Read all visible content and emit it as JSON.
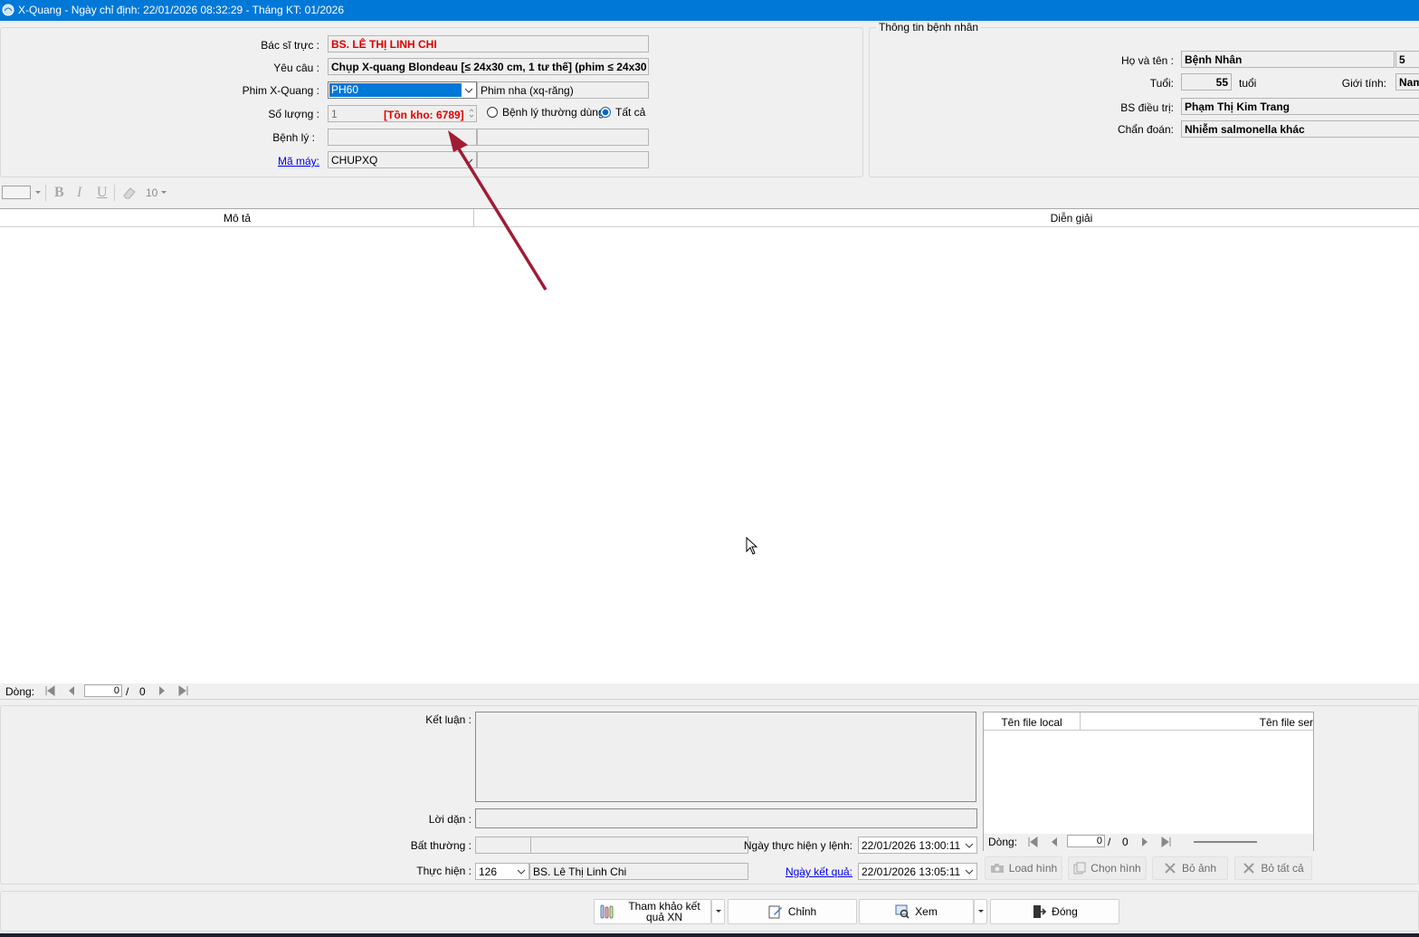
{
  "window": {
    "title": "X-Quang - Ngày chỉ định: 22/01/2026 08:32:29 - Tháng KT: 01/2026"
  },
  "order": {
    "bac_si_truc_label": "Bác sĩ trực :",
    "bac_si_truc_value": "BS. LÊ THỊ LINH CHI",
    "yeu_cau_label": "Yêu câu :",
    "yeu_cau_value": "Chụp X-quang Blondeau [≤ 24x30 cm, 1 tư thế] (phim  ≤ 24x30",
    "phim_label": "Phim X-Quang :",
    "phim_code": "PH60",
    "phim_name": "Phim nha (xq-răng)",
    "so_luong_label": "Số lượng :",
    "so_luong_value": "1",
    "ton_kho": "[Tồn kho: 6789]",
    "radio_benh_ly_thuong_dung": "Bệnh lý thường dùng",
    "radio_tat_ca": "Tất cả",
    "benh_ly_label": "Bệnh lý :",
    "ma_may_label": "Mã máy:",
    "ma_may_value": "CHUPXQ"
  },
  "patient": {
    "group_title": "Thông tin bệnh nhân",
    "ho_ten_label": "Họ và tên :",
    "ho_ten_value": "Bệnh Nhân",
    "ho_ten_extra": "5",
    "tuoi_label": "Tuổi:",
    "tuoi_value": "55",
    "tuoi_unit": "tuổi",
    "gioi_tinh_label": "Giới tính:",
    "gioi_tinh_value": "Nam",
    "bs_dieu_tri_label": "BS điều trị:",
    "bs_dieu_tri_value": "Phạm Thị Kim Trang",
    "chan_doan_label": "Chẩn đoán:",
    "chan_doan_value": "Nhiễm salmonella khác"
  },
  "toolbar": {
    "bold": "B",
    "italic": "I",
    "underline": "U",
    "font_size": "10"
  },
  "grid": {
    "col_mo_ta": "Mô tả",
    "col_dien_giai": "Diễn giải",
    "nav_label": "Dòng:",
    "nav_current": "0",
    "nav_sep": "/",
    "nav_total": "0"
  },
  "result": {
    "ket_luan_label": "Kết luận :",
    "loi_dan_label": "Lời dặn :",
    "bat_thuong_label": "Bất thường :",
    "thuc_hien_label": "Thực hiện :",
    "thuc_hien_code": "126",
    "thuc_hien_name": "BS. Lê Thị Linh Chi",
    "ngay_thuc_hien_label": "Ngày thực hiện y lệnh:",
    "ngay_thuc_hien_value": "22/01/2026  13:00:11",
    "ngay_ket_qua_label": "Ngày kết quả:",
    "ngay_ket_qua_value": "22/01/2026  13:05:11"
  },
  "images": {
    "col_local": "Tên file local",
    "col_server": "Tên file ser",
    "nav_label": "Dòng:",
    "nav_current": "0",
    "nav_sep": "/",
    "nav_total": "0",
    "load_hinh": "Load hình",
    "chon_hinh": "Chọn hình",
    "bo_anh": "Bỏ ảnh",
    "bo_tat_ca": "Bỏ tất cả"
  },
  "actions": {
    "tham_khao": "Tham khảo kết quả XN",
    "chinh": "Chỉnh",
    "xem": "Xem",
    "dong": "Đóng"
  },
  "colors": {
    "title_bar": "#0078d7",
    "selection": "#0078d7",
    "annotation_arrow": "#a01c34",
    "alert_red": "#e00000"
  }
}
